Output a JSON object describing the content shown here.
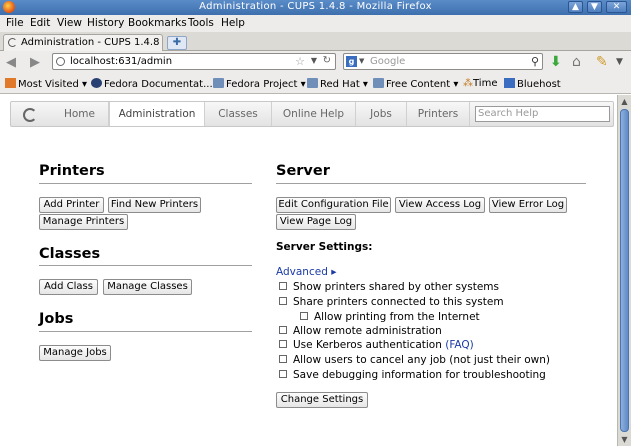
{
  "window": {
    "title": "Administration - CUPS 1.4.8 - Mozilla Firefox",
    "controls": [
      "▲",
      "▼",
      "✕"
    ]
  },
  "menu": [
    "File",
    "Edit",
    "View",
    "History",
    "Bookmarks",
    "Tools",
    "Help"
  ],
  "tab": {
    "label": "Administration - CUPS 1.4.8",
    "new_tab": "✚"
  },
  "nav": {
    "url": "localhost:631/admin",
    "search_placeholder": "Google",
    "search_engine": "g"
  },
  "bookmarks": [
    "Most Visited",
    "Fedora Documentat...",
    "Fedora Project",
    "Red Hat",
    "Free Content",
    "Time",
    "Bluehost"
  ],
  "cups_nav": {
    "items": [
      "Home",
      "Administration",
      "Classes",
      "Online Help",
      "Jobs",
      "Printers"
    ],
    "help_placeholder": "Search Help"
  },
  "printers": {
    "heading": "Printers",
    "buttons": [
      "Add Printer",
      "Find New Printers",
      "Manage Printers"
    ]
  },
  "classes": {
    "heading": "Classes",
    "buttons": [
      "Add Class",
      "Manage Classes"
    ]
  },
  "jobs": {
    "heading": "Jobs",
    "buttons": [
      "Manage Jobs"
    ]
  },
  "server": {
    "heading": "Server",
    "buttons": [
      "Edit Configuration File",
      "View Access Log",
      "View Error Log",
      "View Page Log"
    ],
    "settings_label": "Server Settings:",
    "advanced": "Advanced ▸",
    "options": [
      "Show printers shared by other systems",
      "Share printers connected to this system",
      "Allow printing from the Internet",
      "Allow remote administration",
      "Use Kerberos authentication",
      "Allow users to cancel any job (not just their own)",
      "Save debugging information for troubleshooting"
    ],
    "faq": "(FAQ)",
    "change_button": "Change Settings"
  }
}
